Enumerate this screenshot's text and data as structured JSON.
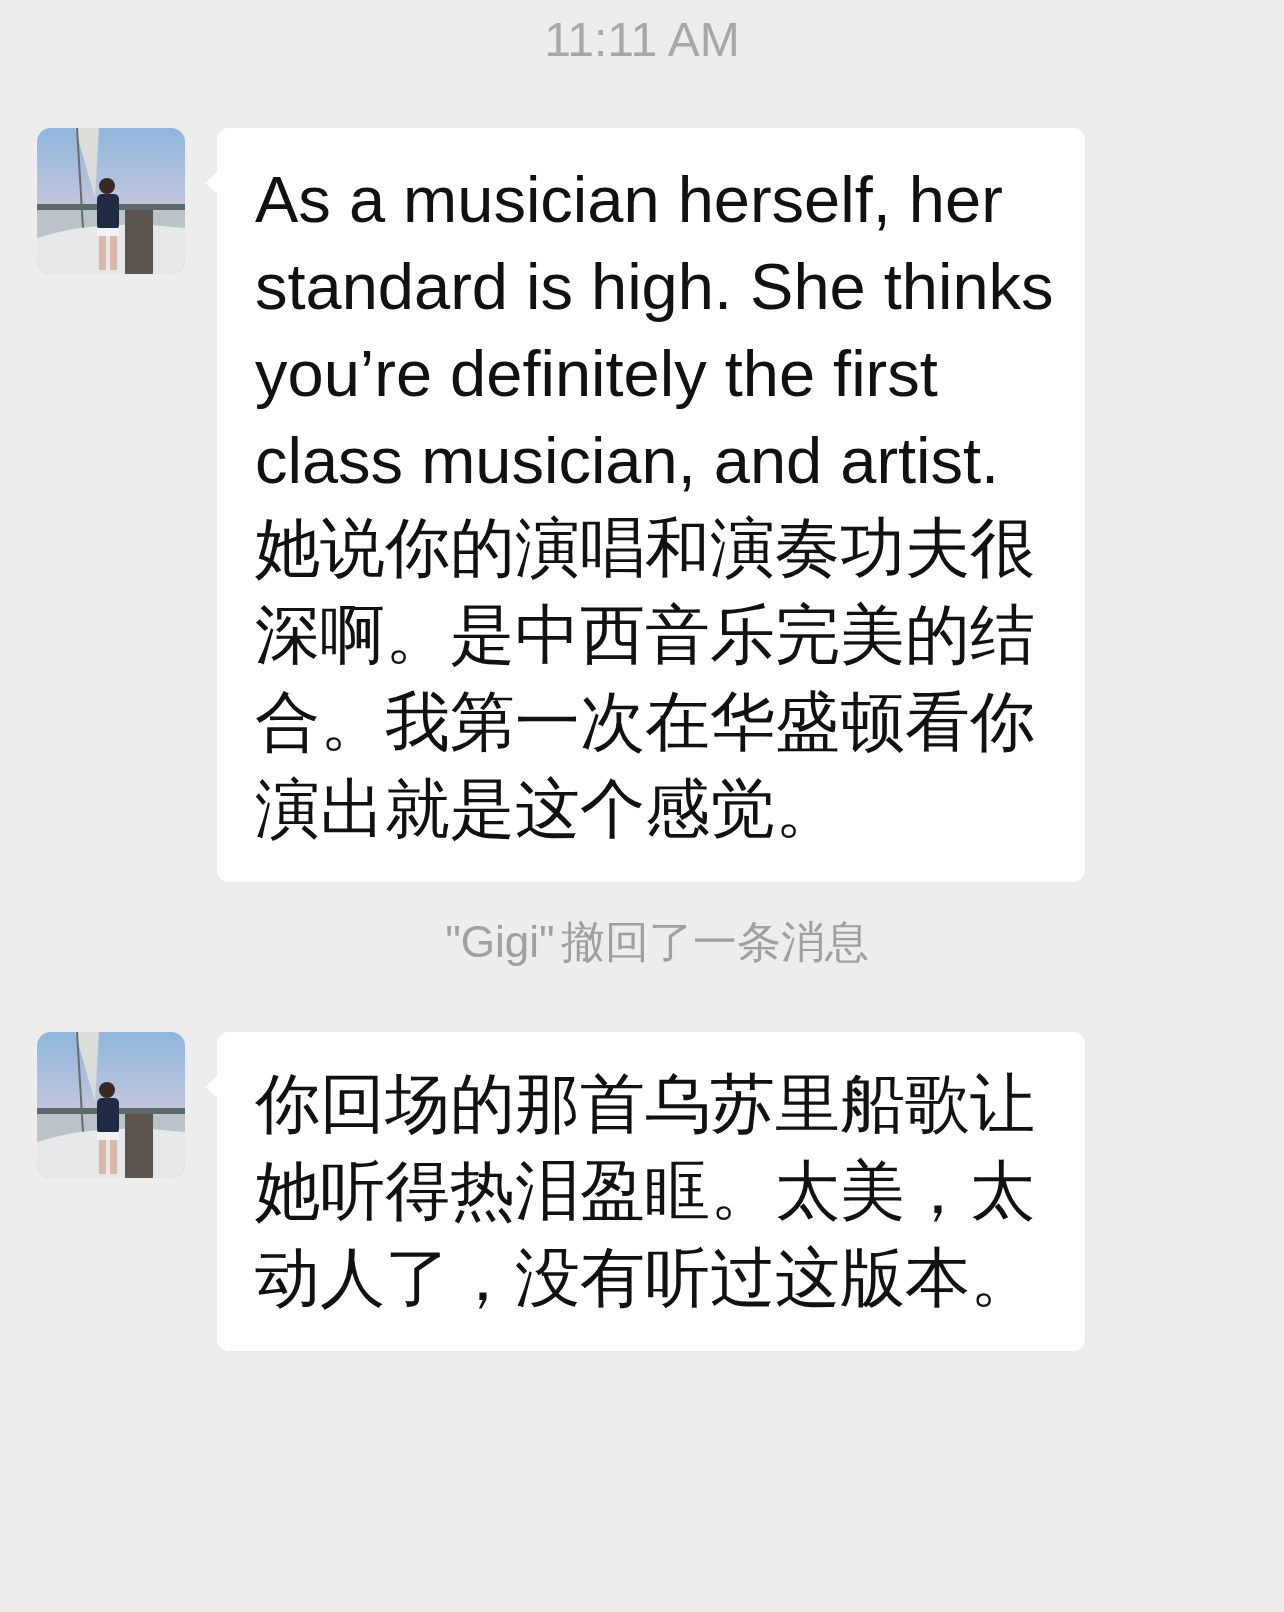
{
  "timestamp": "11:11 AM",
  "messages": [
    {
      "kind": "message",
      "text": "As a musician herself, her standard is high. She thinks you’re definitely the first class musician, and artist. 她说你的演唱和演奏功夫很深啊。是中西音乐完美的结合。我第一次在华盛顿看你演出就是这个感觉。"
    },
    {
      "kind": "notice",
      "name": "\"Gigi\"",
      "text": "撤回了一条消息"
    },
    {
      "kind": "message",
      "text": "你回场的那首乌苏里船歌让她听得热泪盈眶。太美，太动人了，没有听过这版本。"
    }
  ]
}
